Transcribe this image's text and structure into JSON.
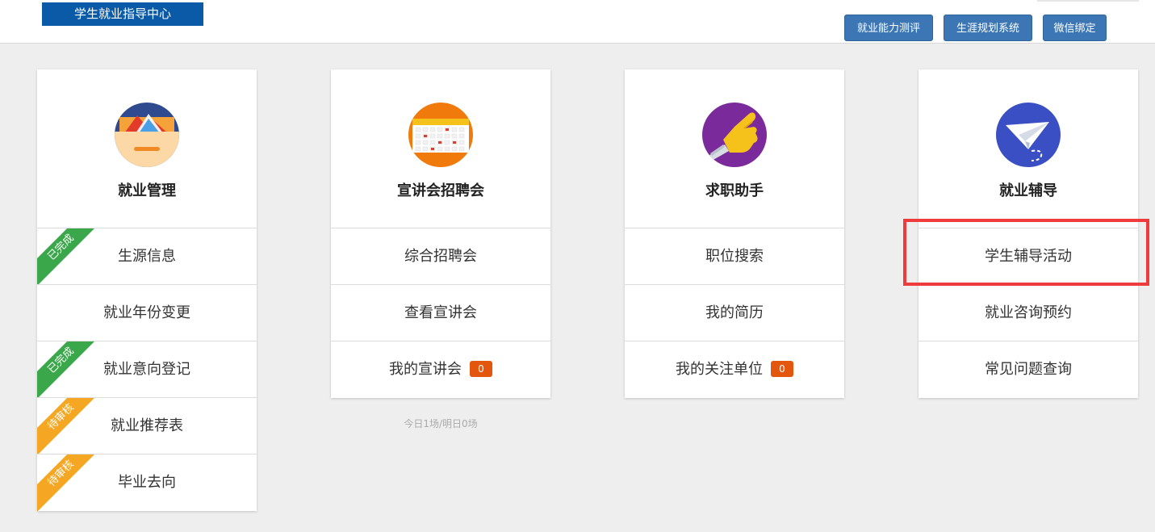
{
  "header": {
    "logo_text": "学生就业指导中心",
    "buttons": [
      {
        "label": "就业能力测评"
      },
      {
        "label": "生涯规划系统"
      },
      {
        "label": "微信绑定"
      }
    ]
  },
  "cards": [
    {
      "title": "就业管理",
      "icon": "folder-mountain-icon",
      "rows": [
        {
          "label": "生源信息",
          "status": "已完成"
        },
        {
          "label": "就业年份变更"
        },
        {
          "label": "就业意向登记",
          "status": "已完成"
        },
        {
          "label": "就业推荐表",
          "status": "待审核"
        },
        {
          "label": "毕业去向",
          "status": "待审核"
        }
      ]
    },
    {
      "title": "宣讲会招聘会",
      "icon": "calendar-icon",
      "rows": [
        {
          "label": "综合招聘会"
        },
        {
          "label": "查看宣讲会"
        },
        {
          "label": "我的宣讲会",
          "badge": "0"
        }
      ],
      "note": "今日1场/明日0场"
    },
    {
      "title": "求职助手",
      "icon": "pointing-hand-icon",
      "rows": [
        {
          "label": "职位搜索"
        },
        {
          "label": "我的简历"
        },
        {
          "label": "我的关注单位",
          "badge": "0"
        }
      ]
    },
    {
      "title": "就业辅导",
      "icon": "paper-plane-icon",
      "rows": [
        {
          "label": "学生辅导活动"
        },
        {
          "label": "就业咨询预约"
        },
        {
          "label": "常见问题查询"
        }
      ]
    }
  ],
  "colors": {
    "logo_bg": "#0a5aa8",
    "header_button_bg": "#3c76b5",
    "badge_bg": "#e2560d",
    "ribbon_done": "#3aa84a",
    "ribbon_pending": "#f5a623",
    "highlight_border": "#ef3b3b"
  }
}
